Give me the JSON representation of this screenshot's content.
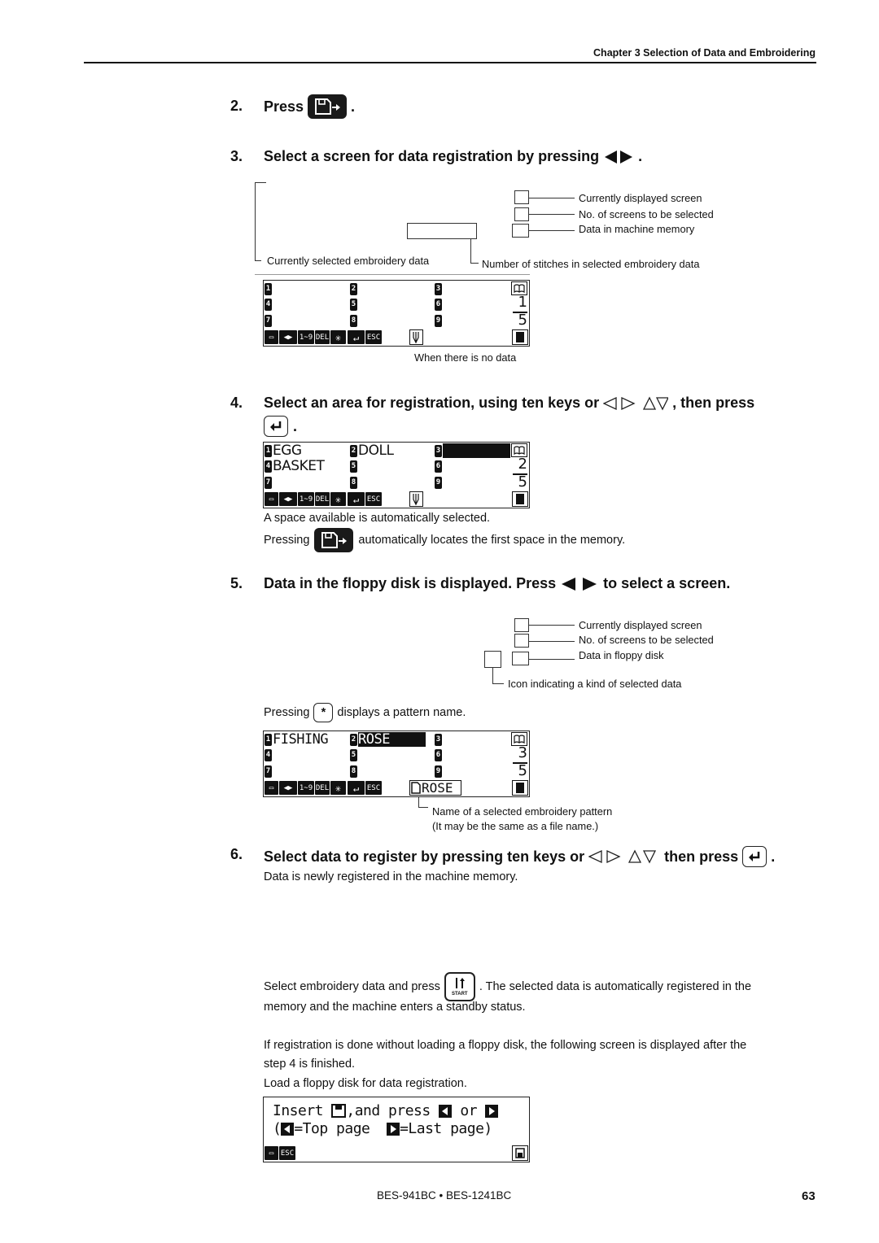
{
  "header": {
    "chapter_title": "Chapter 3 Selection of Data and Embroidering"
  },
  "steps": [
    {
      "num": "2.",
      "text_before": "Press",
      "text_after": "."
    },
    {
      "num": "3.",
      "text": "Select a screen for data registration by pressing",
      "text_after": "."
    },
    {
      "num": "4.",
      "text": "Select an area for registration, using ten keys or",
      "text_mid": ", then press",
      "text_after": "."
    },
    {
      "num": "5.",
      "text": "Data in the floppy disk is displayed.  Press",
      "text_after": "to select a screen."
    },
    {
      "num": "6.",
      "text": "Select data to register by pressing ten keys or",
      "text_mid": "then press",
      "text_after": "."
    }
  ],
  "diagram1": {
    "labels": {
      "current_screen": "Currently displayed screen",
      "num_screens": "No. of screens to be selected",
      "data_memory": "Data in machine memory",
      "selected_data": "Currently selected embroidery data",
      "stitches": "Number of stitches in selected embroidery data"
    },
    "caption": "When there is no data"
  },
  "lcd1": {
    "slots": [
      {
        "n": "1",
        "name": ""
      },
      {
        "n": "2",
        "name": ""
      },
      {
        "n": "3",
        "name": ""
      },
      {
        "n": "4",
        "name": ""
      },
      {
        "n": "5",
        "name": ""
      },
      {
        "n": "6",
        "name": ""
      },
      {
        "n": "7",
        "name": ""
      },
      {
        "n": "8",
        "name": ""
      },
      {
        "n": "9",
        "name": ""
      }
    ],
    "page_current": "1",
    "page_total": "5"
  },
  "lcd2": {
    "slots": [
      {
        "n": "1",
        "name": "EGG"
      },
      {
        "n": "2",
        "name": "DOLL"
      },
      {
        "n": "3",
        "name": ""
      },
      {
        "n": "4",
        "name": "BASKET"
      },
      {
        "n": "5",
        "name": ""
      },
      {
        "n": "6",
        "name": ""
      },
      {
        "n": "7",
        "name": ""
      },
      {
        "n": "8",
        "name": ""
      },
      {
        "n": "9",
        "name": ""
      }
    ],
    "selected_slot": "3",
    "page_current": "2",
    "page_total": "5"
  },
  "toolbar": {
    "save_arrow": "save-arrow",
    "range": "1~9",
    "del": "DEL",
    "asterisk": "✳",
    "enter": "↵",
    "esc": "ESC"
  },
  "notes_step4": {
    "line1": "A space available is automatically selected.",
    "line2_before": "Pressing",
    "line2_after": "automatically locates the first space in the memory."
  },
  "diagram2": {
    "labels": {
      "current_screen": "Currently displayed screen",
      "num_screens": "No. of screens to be selected",
      "data_floppy": "Data in floppy disk",
      "icon_kind": "Icon indicating a kind of selected data"
    }
  },
  "notes_step5": {
    "pressing_before": "Pressing",
    "asterisk_key": "*",
    "pressing_after": "displays a pattern name."
  },
  "lcd3": {
    "slots": [
      {
        "n": "1",
        "name": "FISHING"
      },
      {
        "n": "2",
        "name": "ROSE"
      },
      {
        "n": "3",
        "name": ""
      },
      {
        "n": "4",
        "name": ""
      },
      {
        "n": "5",
        "name": ""
      },
      {
        "n": "6",
        "name": ""
      },
      {
        "n": "7",
        "name": ""
      },
      {
        "n": "8",
        "name": ""
      },
      {
        "n": "9",
        "name": ""
      }
    ],
    "selected_slot": "2",
    "pattern_name": "ROSE",
    "page_current": "3",
    "page_total": "5"
  },
  "caption_lcd3": {
    "line1": "Name of a selected embroidery pattern",
    "line2": "(It may be the same as a file name.)"
  },
  "notes_step6": {
    "line1": "Data is newly registered in the machine memory."
  },
  "para1": {
    "before": "Select embroidery data and press",
    "start_key": "START",
    "after": ".  The selected data is automatically registered in the",
    "line2": "memory and the machine enters a standby status."
  },
  "para2": {
    "line1": "If registration is done without loading a floppy disk, the following screen is displayed after the",
    "line2": "step 4 is finished.",
    "line3": "Load a floppy disk for data registration."
  },
  "lcd4": {
    "line1_a": "Insert ",
    "line1_b": ",and press ",
    "line1_c": " or ",
    "line2_a": "(",
    "line2_b": "=Top page  ",
    "line2_c": "=Last page)",
    "esc": "ESC"
  },
  "footer": {
    "model": "BES-941BC • BES-1241BC",
    "page": "63"
  }
}
